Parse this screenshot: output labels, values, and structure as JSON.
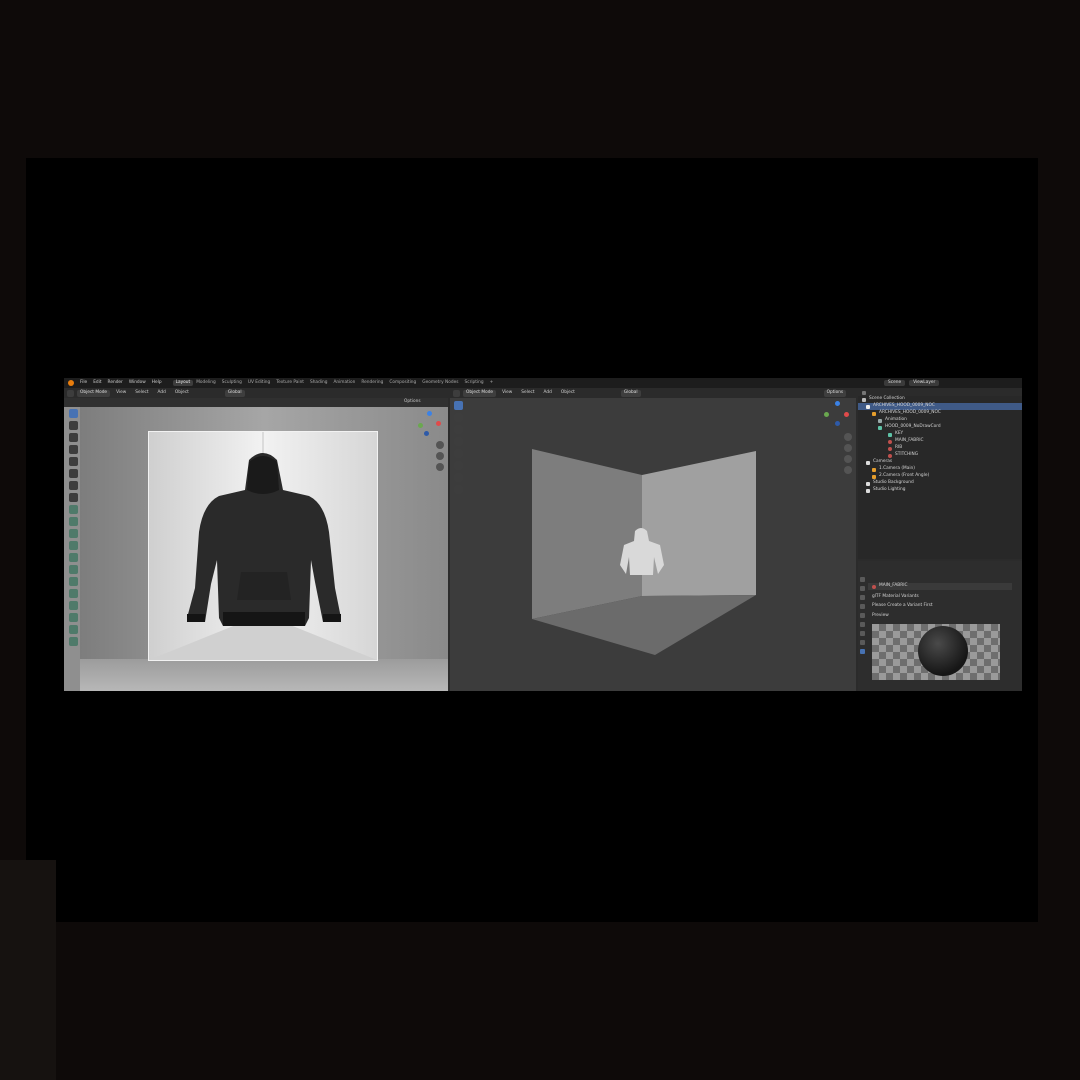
{
  "topbar": {
    "menus": [
      "File",
      "Edit",
      "Render",
      "Window",
      "Help"
    ],
    "workspaces": [
      "Layout",
      "Modeling",
      "Sculpting",
      "UV Editing",
      "Texture Paint",
      "Shading",
      "Animation",
      "Rendering",
      "Compositing",
      "Geometry Nodes",
      "Scripting"
    ],
    "active_workspace": "Layout",
    "add_tab": "+",
    "scene_label": "Scene",
    "viewlayer_label": "ViewLayer"
  },
  "viewport_left": {
    "mode": "Object Mode",
    "menus": [
      "View",
      "Select",
      "Add",
      "Object"
    ],
    "transform": "Global",
    "options": "Options"
  },
  "viewport_right": {
    "mode": "Object Mode",
    "menus": [
      "View",
      "Select",
      "Add",
      "Object"
    ],
    "transform": "Global",
    "options": "Options"
  },
  "outliner": {
    "root": "Scene Collection",
    "rows": [
      {
        "label": "ARCHIVES_HOOD_0009_NOC",
        "depth": 0,
        "selected": true
      },
      {
        "label": "ARCHIVES_HOOD_0009_NOC",
        "depth": 1,
        "selected": false
      },
      {
        "label": "Animation",
        "depth": 2,
        "selected": false
      },
      {
        "label": "HOOD_0009_NoDrawCord",
        "depth": 2,
        "selected": false
      },
      {
        "label": "KEY",
        "depth": 3,
        "selected": false
      },
      {
        "label": "MAIN_FABRIC",
        "depth": 3,
        "selected": false
      },
      {
        "label": "RIB",
        "depth": 3,
        "selected": false
      },
      {
        "label": "STITCHING",
        "depth": 3,
        "selected": false
      },
      {
        "label": "Cameras",
        "depth": 0,
        "selected": false
      },
      {
        "label": "1.Camera (Main)",
        "depth": 1,
        "selected": false
      },
      {
        "label": "2.Camera (Front Angle)",
        "depth": 1,
        "selected": false
      },
      {
        "label": "Studio Background",
        "depth": 0,
        "selected": false
      },
      {
        "label": "Studio Lighting",
        "depth": 0,
        "selected": false
      }
    ]
  },
  "properties": {
    "material_name": "MAIN_FABRIC",
    "panel_variants": "glTF Material Variants",
    "variants_hint": "Please Create a Variant First",
    "panel_preview": "Preview"
  },
  "colors": {
    "accent": "#4772b3",
    "logo": "#e87d0d",
    "selected_row": "#3f5a87"
  }
}
